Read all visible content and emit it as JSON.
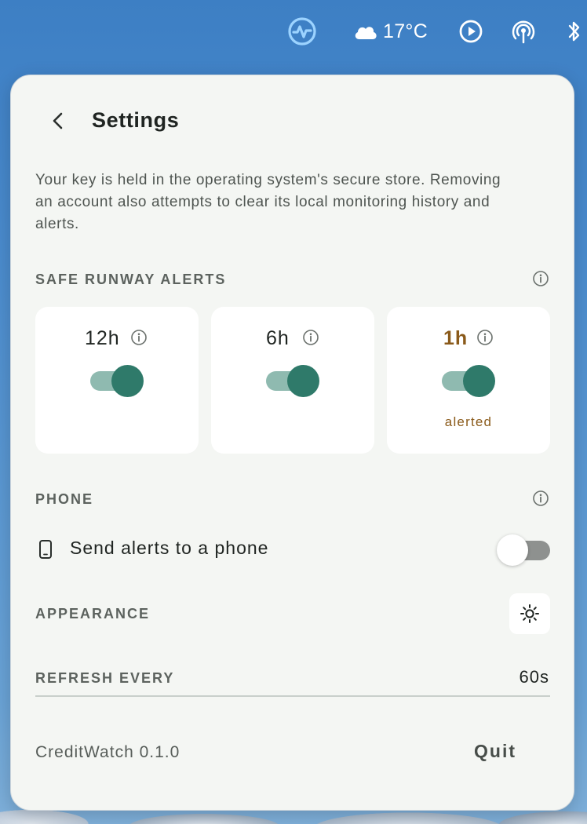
{
  "menubar": {
    "app_icon": "activity-pulse-icon",
    "weather_icon": "cloud-icon",
    "temperature": "17°C",
    "play_icon": "play-circle-icon",
    "airplay_icon": "wireless-broadcast-icon",
    "bluetooth_icon": "bluetooth-icon"
  },
  "panel": {
    "title": "Settings",
    "back_icon": "chevron-left-icon",
    "description": "Your key is held in the operating system's secure store. Removing an account also attempts to clear its local monitoring history and alerts.",
    "runway": {
      "label": "SAFE RUNWAY ALERTS",
      "info_icon": "info-icon",
      "cards": [
        {
          "label": "12h",
          "enabled": true,
          "status": ""
        },
        {
          "label": "6h",
          "enabled": true,
          "status": ""
        },
        {
          "label": "1h",
          "enabled": true,
          "status": "alerted"
        }
      ]
    },
    "phone": {
      "label": "PHONE",
      "option_label": "Send alerts to a phone",
      "enabled": false,
      "icon": "smartphone-icon"
    },
    "appearance": {
      "label": "APPEARANCE",
      "icon": "sun-icon"
    },
    "refresh": {
      "label": "REFRESH EVERY",
      "value": "60s"
    },
    "footer": {
      "version": "CreditWatch 0.1.0",
      "quit_label": "Quit"
    }
  },
  "colors": {
    "accent": "#2f7a6a",
    "accent_track": "#8fbab0",
    "alert": "#8a5a1a",
    "panel_bg": "#f4f6f3"
  }
}
